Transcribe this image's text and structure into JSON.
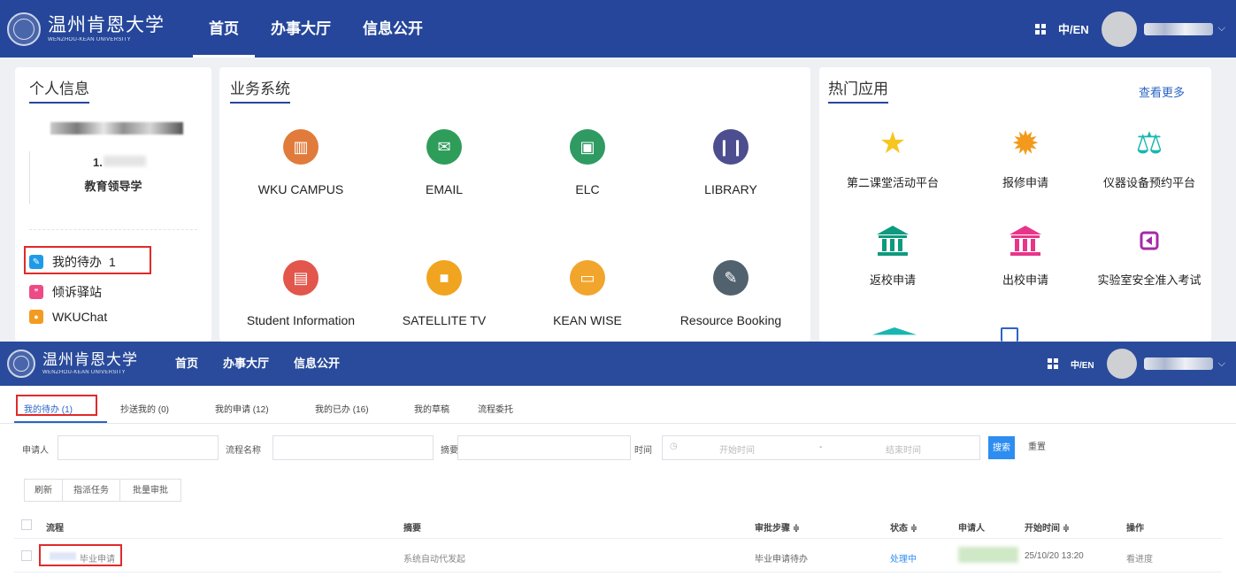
{
  "top_nav": {
    "logo_cn": "温州肯恩大学",
    "logo_en": "WENZHOU-KEAN UNIVERSITY",
    "menu": [
      "首页",
      "办事大厅",
      "信息公开"
    ],
    "lang": "中/EN"
  },
  "personal": {
    "title": "个人信息",
    "id_prefix": "1.",
    "program": "教育领导学",
    "links": [
      {
        "label": "我的待办",
        "badge": "1",
        "icon": "todo-icon",
        "color": "#1e9be8"
      },
      {
        "label": "倾诉驿站",
        "icon": "chat-bubble-icon",
        "color": "#ee4a86"
      },
      {
        "label": "WKUChat",
        "icon": "wkuchat-icon",
        "color": "#f39b21"
      }
    ]
  },
  "business": {
    "title": "业务系统",
    "items": [
      {
        "label": "WKU CAMPUS",
        "icon": "campus-building-icon",
        "color": "#e07b3c"
      },
      {
        "label": "EMAIL",
        "icon": "envelope-icon",
        "color": "#2f9d5a"
      },
      {
        "label": "ELC",
        "icon": "elc-graduation-icon",
        "color": "#2f9a62"
      },
      {
        "label": "LIBRARY",
        "icon": "library-books-icon",
        "color": "#4c4e8f"
      },
      {
        "label": "Student Information",
        "icon": "student-id-card-icon",
        "color": "#e2564b"
      },
      {
        "label": "SATELLITE TV",
        "icon": "video-camera-icon",
        "color": "#f0a41f"
      },
      {
        "label": "KEAN WISE",
        "icon": "monitor-icon",
        "color": "#f2a52c"
      },
      {
        "label": "Resource Booking",
        "icon": "edit-document-icon",
        "color": "#51616e"
      }
    ]
  },
  "hot_apps": {
    "title": "热门应用",
    "more": "查看更多",
    "items": [
      {
        "label": "第二课堂活动平台",
        "icon": "star-icon",
        "glyph": "★",
        "color": "#f7c520"
      },
      {
        "label": "报修申请",
        "icon": "gear-icon",
        "glyph": "✹",
        "color": "#f39a1e"
      },
      {
        "label": "仪器设备预约平台",
        "icon": "balance-scale-icon",
        "glyph": "⚖",
        "color": "#19b6b0"
      },
      {
        "label": "返校申请",
        "icon": "bank-building-icon",
        "glyph": "🏛",
        "color": "#0e9a7e"
      },
      {
        "label": "出校申请",
        "icon": "bank-building-pink-icon",
        "glyph": "🏛",
        "color": "#e8358a"
      },
      {
        "label": "实验室安全准入考试",
        "icon": "back-square-icon",
        "glyph": "◧",
        "color": "#a52aa8"
      }
    ]
  },
  "workflow": {
    "tabs": [
      "我的待办 (1)",
      "抄送我的 (0)",
      "我的申请 (12)",
      "我的已办 (16)",
      "我的草稿",
      "流程委托"
    ],
    "filters": {
      "applicant": "申请人",
      "process_name": "流程名称",
      "summary": "摘要",
      "time": "时间",
      "start_placeholder": "开始时间",
      "dash": "-",
      "end_placeholder": "结束时间",
      "search": "搜索",
      "reset": "重置"
    },
    "actions": [
      "刷新",
      "指派任务",
      "批量审批"
    ],
    "columns": [
      "流程",
      "摘要",
      "审批步骤 ≑",
      "状态 ≑",
      "申请人",
      "开始时间 ≑",
      "操作"
    ],
    "row": {
      "process": "毕业申请",
      "summary": "系统自动代发起",
      "step": "毕业申请待办",
      "status": "处理中",
      "start_time": "25/10/20 13:20",
      "action": "看进度"
    }
  }
}
